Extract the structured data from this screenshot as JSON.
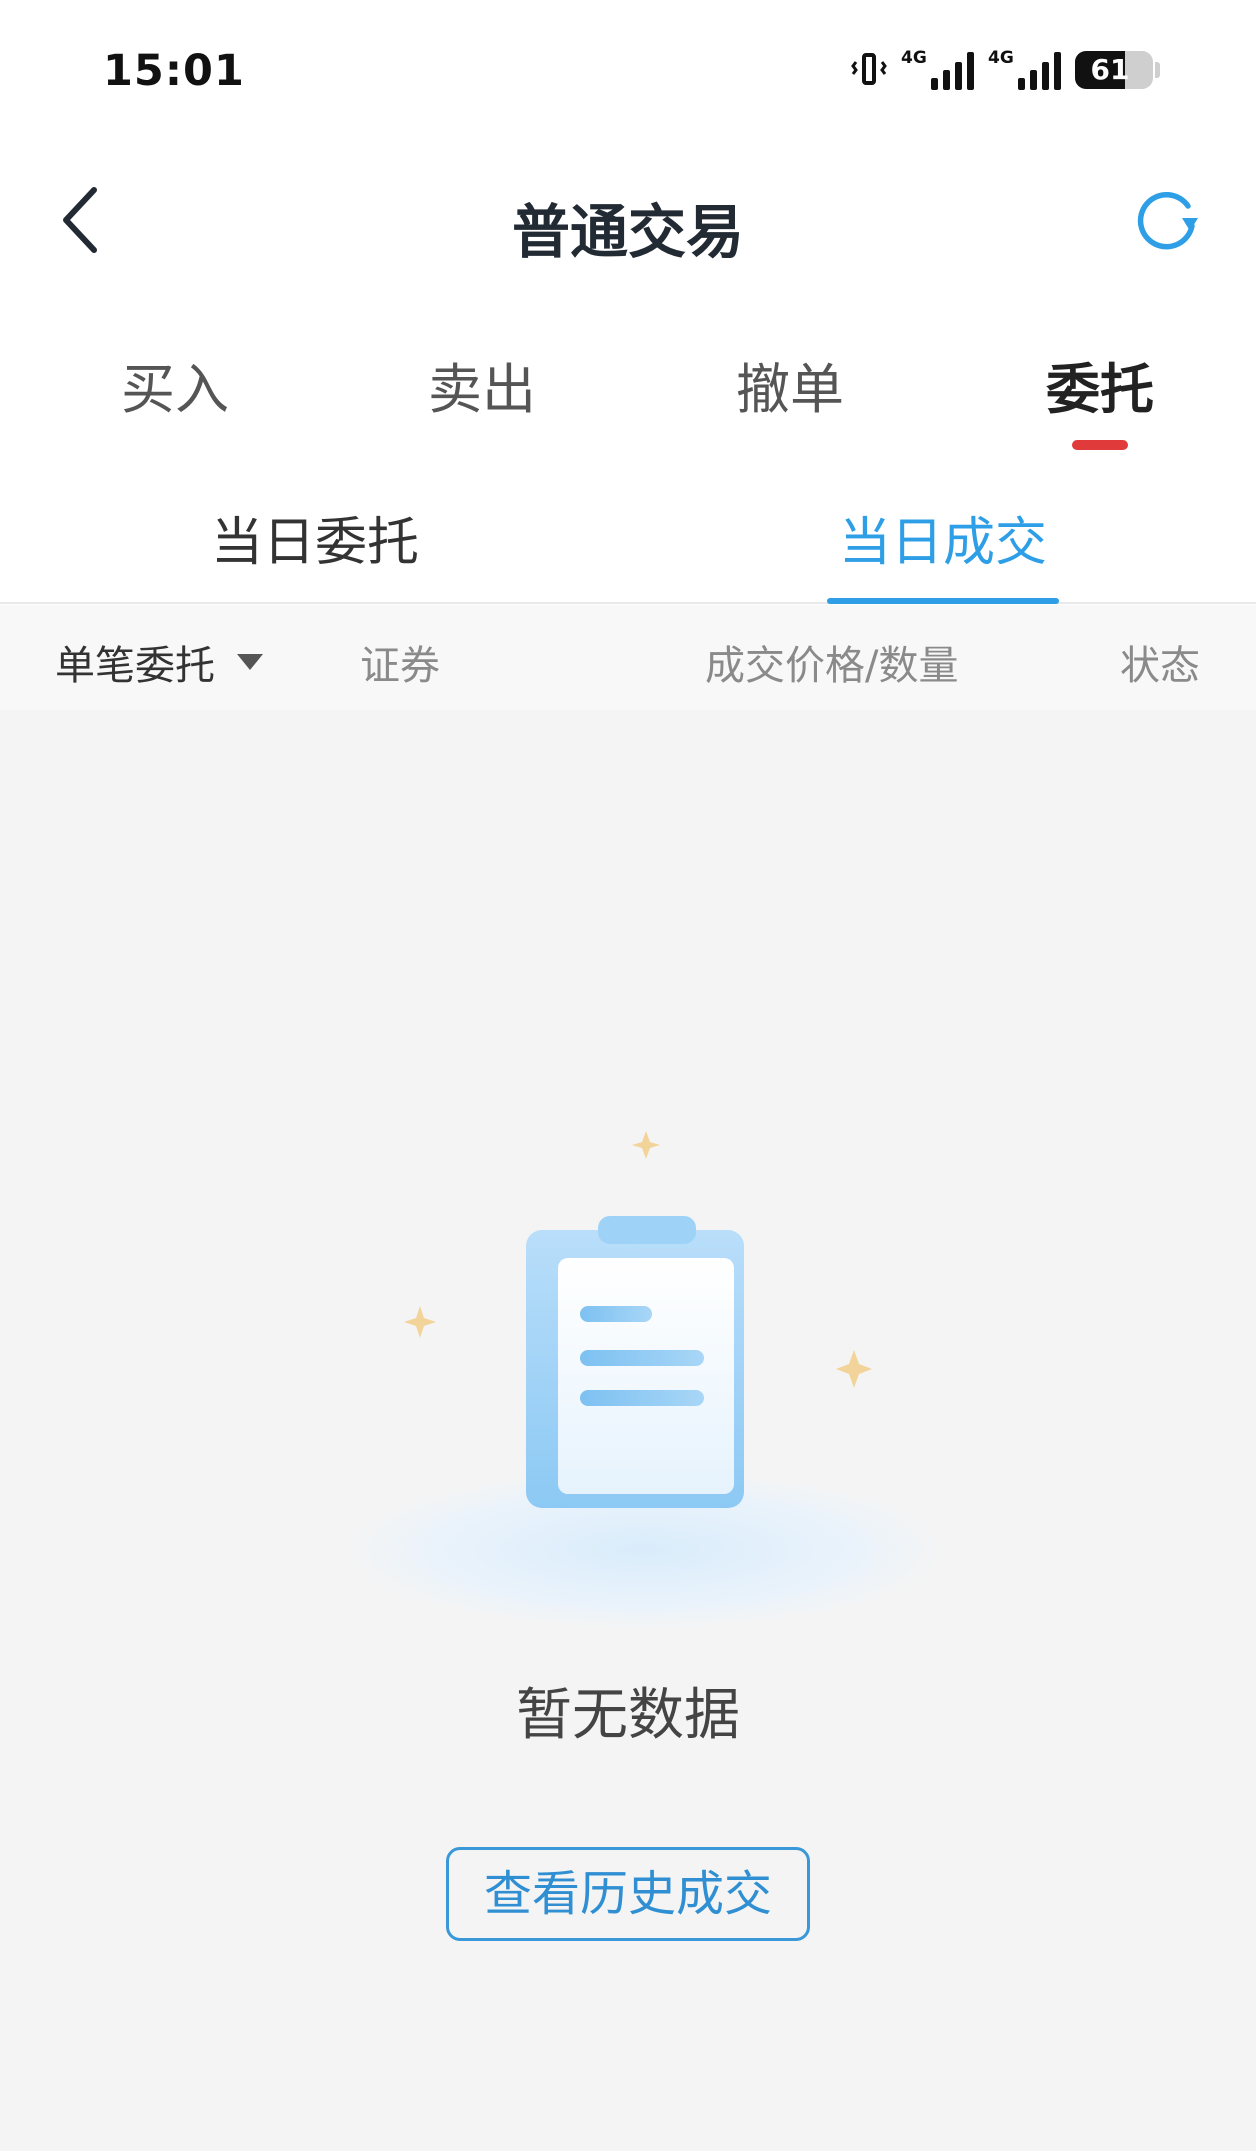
{
  "status_bar": {
    "time": "15:01",
    "network_1": "4G",
    "network_2": "4G",
    "battery": "61"
  },
  "header": {
    "title": "普通交易"
  },
  "main_tabs": [
    {
      "label": "买入",
      "active": false
    },
    {
      "label": "卖出",
      "active": false
    },
    {
      "label": "撤单",
      "active": false
    },
    {
      "label": "委托",
      "active": true
    }
  ],
  "sub_tabs": [
    {
      "label": "当日委托",
      "active": false
    },
    {
      "label": "当日成交",
      "active": true
    }
  ],
  "table_header": {
    "filter": "单笔委托",
    "col_security": "证券",
    "col_price_qty": "成交价格/数量",
    "col_status": "状态"
  },
  "empty_state": {
    "message": "暂无数据",
    "button": "查看历史成交"
  },
  "colors": {
    "accent_blue": "#2e9fe6",
    "active_red": "#e03a3a",
    "title": "#222a33"
  },
  "icons": {
    "back": "chevron-left-icon",
    "refresh": "refresh-icon",
    "filter": "triangle-down-icon",
    "empty": "clipboard-illustration"
  }
}
